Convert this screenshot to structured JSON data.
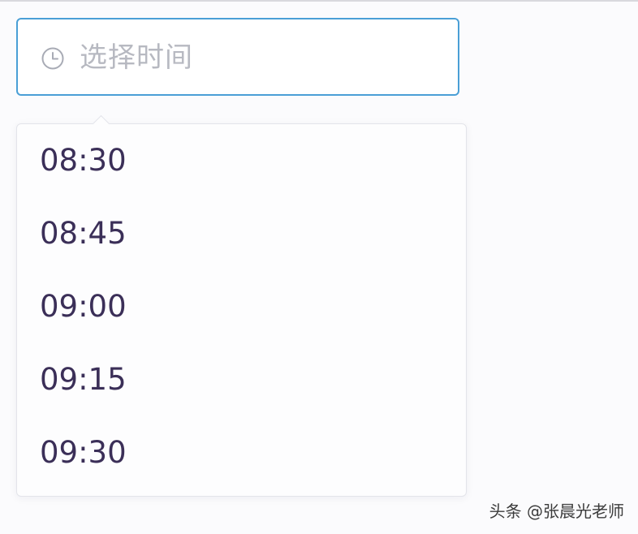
{
  "time_picker": {
    "placeholder": "选择时间",
    "icon": "clock-icon",
    "focus_border_color": "#4a9fd6",
    "options": [
      "08:30",
      "08:45",
      "09:00",
      "09:15",
      "09:30"
    ]
  },
  "watermark": {
    "text": "头条 @张晨光老师"
  }
}
